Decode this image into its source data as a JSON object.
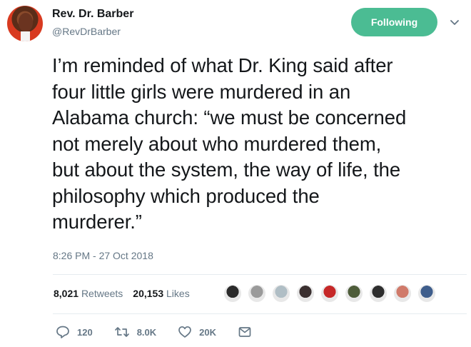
{
  "author": {
    "name": "Rev. Dr. Barber",
    "handle": "@RevDrBarber"
  },
  "follow_button": {
    "label": "Following"
  },
  "tweet": {
    "text": "I’m reminded of what Dr. King said after four little girls were murdered in an Alabama church: “we must be concerned not merely about who murdered them, but about the system, the way of life, the philosophy which produced the murderer.”",
    "lines": [
      "I’m reminded of what Dr. King said after",
      "four little girls were murdered in an",
      "Alabama church: “we must be concerned",
      "not merely about who murdered them,",
      "but about the system, the way of life, the",
      "philosophy which produced the",
      "murderer.”"
    ],
    "timestamp": "8:26 PM - 27 Oct 2018"
  },
  "stats": {
    "retweets_count": "8,021",
    "retweets_label": "Retweets",
    "likes_count": "20,153",
    "likes_label": "Likes"
  },
  "likers_colors": [
    "#2b2b2b",
    "#9a9a9a",
    "#b0bec5",
    "#3b3030",
    "#c62828",
    "#4e5d3a",
    "#2e2e2e",
    "#d07a6a",
    "#3f5e8c"
  ],
  "actions": {
    "reply_count": "120",
    "retweet_count": "8.0K",
    "like_count": "20K"
  },
  "icons": {
    "reply": "reply-icon",
    "retweet": "retweet-icon",
    "like": "heart-icon",
    "dm": "envelope-icon",
    "caret": "chevron-down-icon"
  }
}
